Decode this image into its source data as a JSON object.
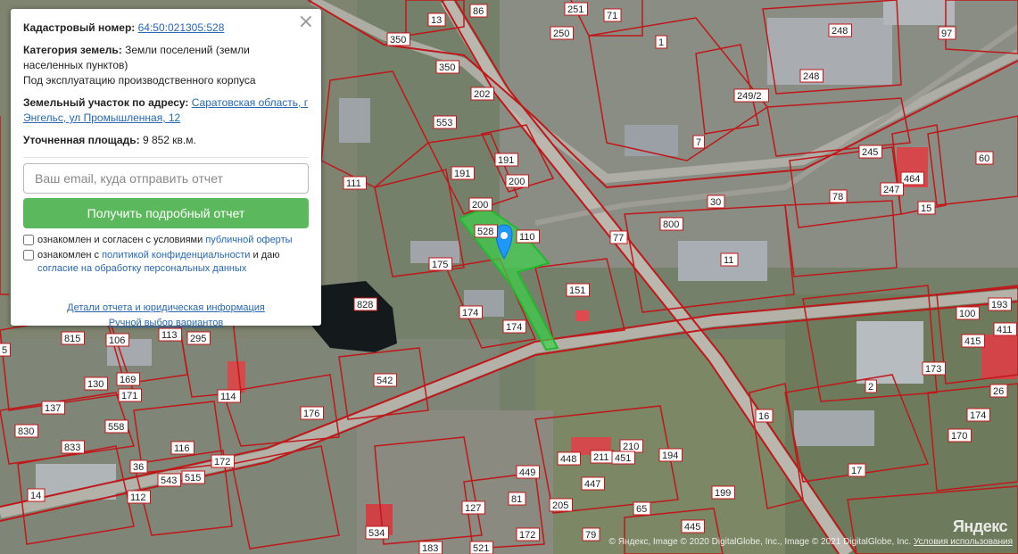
{
  "popup": {
    "cadastral_label": "Кадастровый номер:",
    "cadastral_number": "64:50:021305:528",
    "category_label": "Категория земель:",
    "category_value": "Земли поселений (земли населенных пунктов)",
    "usage": "Под эксплуатацию производственного корпуса",
    "address_label": "Земельный участок по адресу:",
    "address_value": "Саратовская область, г Энгельс, ул Промышленная, 12",
    "area_label": "Уточненная площадь:",
    "area_value": "9 852 кв.м.",
    "email_placeholder": "Ваш email, куда отправить отчет",
    "report_button": "Получить подробный отчет",
    "consent1_prefix": "ознакомлен и согласен с условиями",
    "consent1_link": "публичной оферты",
    "consent2_prefix": "ознакомлен с",
    "consent2_link1": "политикой конфиденциальности",
    "consent2_mid": "и даю",
    "consent2_link2": "согласие на обработку персональных данных",
    "details_link": "Детали отчета и юридическая информация",
    "manual_link": "Ручной выбор вариантов",
    "close_icon": "close-icon"
  },
  "map": {
    "parcel_labels": [
      "13",
      "86",
      "251",
      "71",
      "248",
      "97",
      "350",
      "250",
      "1",
      "350",
      "202",
      "553",
      "248",
      "249/2",
      "7",
      "191",
      "191",
      "200",
      "200",
      "245",
      "60",
      "464",
      "111",
      "528",
      "110",
      "30",
      "78",
      "247",
      "15",
      "800",
      "77",
      "175",
      "11",
      "151",
      "828",
      "174",
      "174",
      "193",
      "100",
      "411",
      "815",
      "106",
      "113",
      "295",
      "5",
      "169",
      "137",
      "130",
      "171",
      "542",
      "114",
      "176",
      "2",
      "173",
      "415",
      "26",
      "830",
      "558",
      "116",
      "16",
      "174",
      "170",
      "833",
      "36",
      "172",
      "515",
      "543",
      "211",
      "210",
      "448",
      "451",
      "194",
      "17",
      "112",
      "449",
      "447",
      "205",
      "81",
      "65",
      "199",
      "127",
      "79",
      "445",
      "172",
      "183",
      "521",
      "534",
      "14"
    ],
    "marker_icon": "location-pin-icon",
    "selected_parcel": "528"
  },
  "attribution": {
    "brand": "Яндекс",
    "copyright": "© Яндекс, Image © 2020 DigitalGlobe, Inc., Image © 2021 DigitalGlobe, Inc.",
    "terms_link": "Условия использования"
  },
  "colors": {
    "parcel_border": "#c0181a",
    "selected_fill": "#3cd24a",
    "button_green": "#5cb85c",
    "link_blue": "#2767b5"
  }
}
